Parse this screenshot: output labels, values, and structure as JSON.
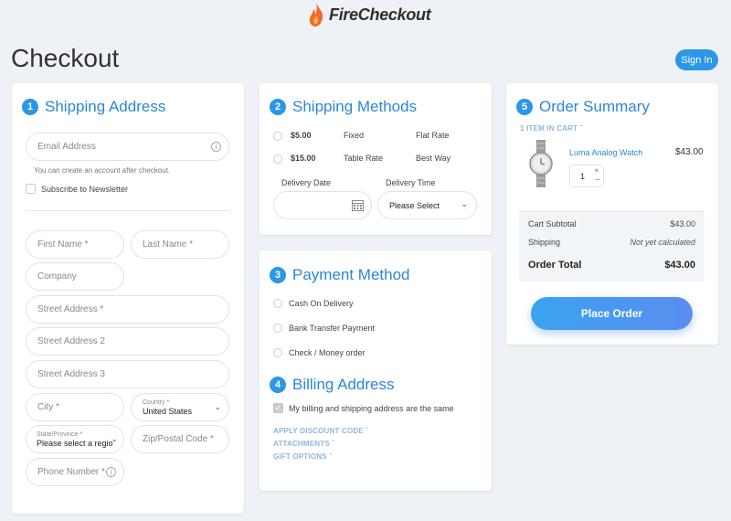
{
  "header": {
    "logo_text": "FireCheckout",
    "page_title": "Checkout",
    "signin_label": "Sign In"
  },
  "shipping_address": {
    "step": "1",
    "title": "Shipping Address",
    "email_placeholder": "Email Address",
    "email_note": "You can create an account after checkout.",
    "newsletter_label": "Subscribe to Newsletter",
    "first_name": "First Name *",
    "last_name": "Last Name *",
    "company": "Company",
    "street1": "Street Address *",
    "street2": "Street Address 2",
    "street3": "Street Address 3",
    "city": "City *",
    "country_label": "Country *",
    "country_value": "United States",
    "region_label": "State/Province *",
    "region_value": "Please select a regio",
    "zip": "Zip/Postal Code *",
    "phone": "Phone Number *",
    "info_glyph": "i"
  },
  "shipping_methods": {
    "step": "2",
    "title": "Shipping Methods",
    "rows": [
      {
        "price": "$5.00",
        "method": "Fixed",
        "carrier": "Flat Rate"
      },
      {
        "price": "$15.00",
        "method": "Table Rate",
        "carrier": "Best Way"
      }
    ],
    "delivery_date_label": "Delivery Date",
    "delivery_time_label": "Delivery Time",
    "delivery_time_value": "Please Select"
  },
  "payment": {
    "step": "3",
    "title": "Payment Method",
    "options": [
      "Cash On Delivery",
      "Bank Transfer Payment",
      "Check / Money order"
    ]
  },
  "billing": {
    "step": "4",
    "title": "Billing Address",
    "same_label": "My billing and shipping address are the same",
    "links": [
      "APPLY DISCOUNT CODE",
      "ATTACHMENTS",
      "GIFT OPTIONS"
    ]
  },
  "summary": {
    "step": "5",
    "title": "Order Summary",
    "items_in_cart": "1 ITEM IN CART",
    "item_name": "Luma Analog Watch",
    "item_price": "$43.00",
    "qty": "1",
    "cart_subtotal_label": "Cart Subtotal",
    "cart_subtotal_value": "$43.00",
    "shipping_label": "Shipping",
    "shipping_value": "Not yet calculated",
    "order_total_label": "Order Total",
    "order_total_value": "$43.00",
    "place_order_label": "Place Order"
  }
}
